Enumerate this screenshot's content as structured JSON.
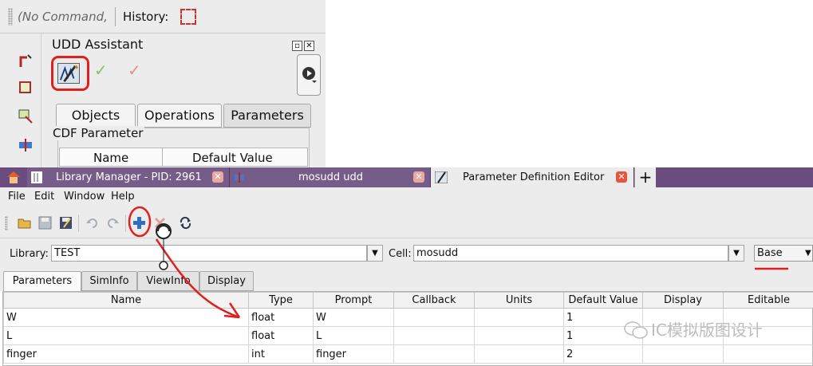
{
  "assistant": {
    "command_placeholder": "(No Command,",
    "history_label": "History:",
    "title": "UDD Assistant",
    "tabs": [
      "Objects",
      "Operations",
      "Parameters"
    ],
    "active_tab": "Parameters",
    "group_title": "CDF Parameter",
    "group_columns": [
      "Name",
      "Default Value"
    ]
  },
  "window_tabs": [
    {
      "label": "Library Manager -  PID: 2961",
      "active": false
    },
    {
      "label": "mosudd udd",
      "active": false
    },
    {
      "label": "Parameter Definition Editor",
      "active": true
    }
  ],
  "menu": [
    "File",
    "Edit",
    "Window",
    "Help"
  ],
  "selector": {
    "library_label": "Library:",
    "library_value": "TEST",
    "cell_label": "Cell:",
    "cell_value": "mosudd",
    "view_value": "Base"
  },
  "param_tabs": [
    "Parameters",
    "SimInfo",
    "ViewInfo",
    "Display"
  ],
  "active_param_tab": "Parameters",
  "table": {
    "columns": [
      "Name",
      "Type",
      "Prompt",
      "Callback",
      "Units",
      "Default Value",
      "Display",
      "Editable"
    ],
    "rows": [
      [
        "W",
        "float",
        "W",
        "",
        "",
        "1",
        "",
        ""
      ],
      [
        "L",
        "float",
        "L",
        "",
        "",
        "1",
        "",
        ""
      ],
      [
        "finger",
        "int",
        "finger",
        "",
        "",
        "2",
        "",
        ""
      ]
    ]
  },
  "watermark": "IC模拟版图设计",
  "colors": {
    "tabbar": "#6b4c7f",
    "annotation_red": "#e02020",
    "close_button": "#e8553c"
  }
}
